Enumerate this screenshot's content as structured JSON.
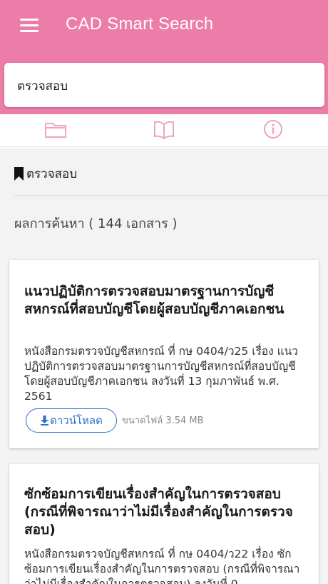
{
  "header": {
    "title": "CAD Smart Search",
    "menu_icon": "menu-icon"
  },
  "search": {
    "value": "ตรวจสอบ"
  },
  "tabs": [
    {
      "icon": "folder-icon"
    },
    {
      "icon": "book-icon"
    },
    {
      "icon": "info-icon"
    }
  ],
  "keyword": {
    "icon": "bookmark-icon",
    "text": "ตรวจสอบ"
  },
  "result_count": "ผลการค้นหา ( 144 เอกสาร )",
  "results": [
    {
      "title": "แนวปฏิบัติการตรวจสอบมาตรฐานการบัญชีสหกรณ์ที่สอบบัญชีโดยผู้สอบบัญชีภาคเอกชน",
      "description": "หนังสือกรมตรวจบัญชีสหกรณ์ ที่ กษ 0404/ว25 เรื่อง แนวปฏิบัติการตรวจสอบมาตรฐานการบัญชีสหกรณ์ที่สอบบัญชีโดยผู้สอบบัญชีภาคเอกชน ลงวันที่ 13 กุมภาพันธ์ พ.ศ. 2561",
      "download_label": "ดาวน์โหลด",
      "filesize": "ขนาดไฟล์ 3.54 MB"
    },
    {
      "title": "ซักซ้อมการเขียนเรื่องสำคัญในการตรวจสอบ (กรณีที่พิจารณาว่าไม่มีเรื่องสำคัญในการตรวจสอบ)",
      "description": "หนังสือกรมตรวจบัญชีสหกรณ์ ที่ กษ 0404/ว22 เรื่อง ซักซ้อมการเขียนเรื่องสำคัญในการตรวจสอบ (กรณีที่พิจารณาว่าไม่มีเรื่องสำคัญในการตรวจสอบ) ลงวันที่ 0"
    }
  ],
  "colors": {
    "appbar": "#ec7ca8",
    "tab_icon": "#f0a3c2",
    "accent_blue": "#2a6fc9"
  }
}
